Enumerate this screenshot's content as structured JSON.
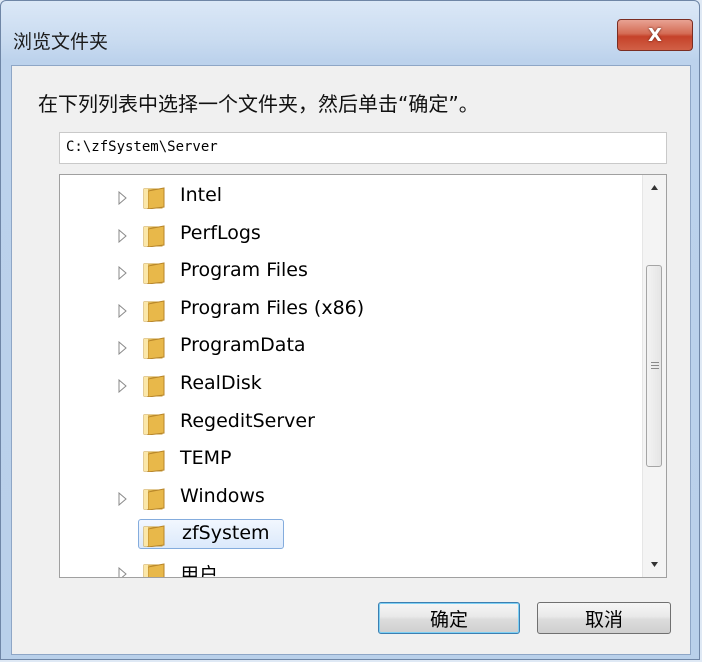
{
  "window": {
    "title": "浏览文件夹",
    "close_label": "X"
  },
  "dialog": {
    "instruction": "在下列列表中选择一个文件夹，然后单击“确定”。",
    "path_value": "C:\\zfSystem\\Server"
  },
  "tree": {
    "items": [
      {
        "label": "Intel",
        "expandable": true,
        "selected": false
      },
      {
        "label": "PerfLogs",
        "expandable": true,
        "selected": false
      },
      {
        "label": "Program Files",
        "expandable": true,
        "selected": false
      },
      {
        "label": "Program Files (x86)",
        "expandable": true,
        "selected": false
      },
      {
        "label": "ProgramData",
        "expandable": true,
        "selected": false
      },
      {
        "label": "RealDisk",
        "expandable": true,
        "selected": false
      },
      {
        "label": "RegeditServer",
        "expandable": false,
        "selected": false
      },
      {
        "label": "TEMP",
        "expandable": false,
        "selected": false
      },
      {
        "label": "Windows",
        "expandable": true,
        "selected": false
      },
      {
        "label": "zfSystem",
        "expandable": false,
        "selected": true
      },
      {
        "label": "用户",
        "expandable": true,
        "selected": false
      }
    ]
  },
  "buttons": {
    "ok_label": "确定",
    "cancel_label": "取消"
  },
  "colors": {
    "folder": "#e8b84a",
    "selection_border": "#84acdd",
    "close_red": "#c5422a"
  }
}
